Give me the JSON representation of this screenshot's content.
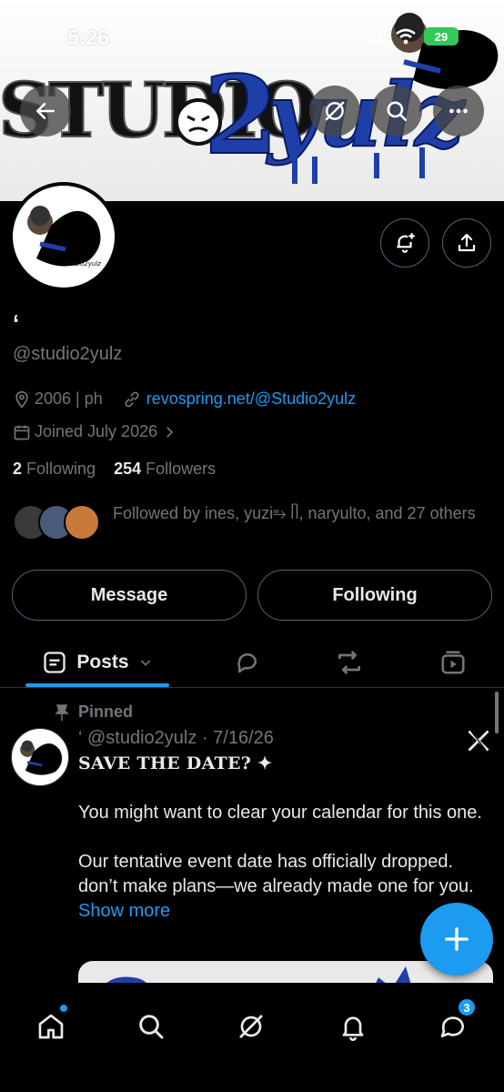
{
  "status_bar": {
    "time": "5:26",
    "battery": "29"
  },
  "banner": {
    "brand_text": "STUDIO",
    "brand_number": "2",
    "brand_suffix": "yulz"
  },
  "profile": {
    "display_name": "‘",
    "handle": "@studio2yulz",
    "location": "2006 | ph",
    "website": "revospring.net/@Studio2yulz",
    "joined": "Joined July 2026",
    "following_count": "2",
    "following_label": "Following",
    "followers_count": "254",
    "followers_label": "Followers",
    "followed_by": "Followed by ines, yuzi⥱ ᥥ, naryulto, and 27 others"
  },
  "actions": {
    "message": "Message",
    "following": "Following"
  },
  "tabs": {
    "posts": "Posts"
  },
  "post": {
    "pinned_label": "Pinned",
    "author": "‘ @studio2yulz",
    "separator": "·",
    "date": "7/16/26",
    "title": "SAVE THE DATE? ✦",
    "paragraph_1": "You might want to clear your calendar for this one.",
    "paragraph_2": "Our tentative event date has officially dropped. don’t make plans—we already made one for you.",
    "show_more": "Show more"
  },
  "nav": {
    "messages_badge": "3"
  },
  "colors": {
    "accent": "#1d9bf0",
    "muted": "#71767b",
    "text": "#e7e9ea",
    "border": "#536471"
  },
  "icons": [
    "back-arrow-icon",
    "grok-icon",
    "search-icon",
    "more-icon",
    "notify-plus-icon",
    "share-icon",
    "location-icon",
    "link-icon",
    "calendar-icon",
    "chevron-right-icon",
    "posts-icon",
    "chevron-down-icon",
    "replies-icon",
    "reposts-icon",
    "media-icon",
    "pin-icon",
    "x-logo-icon",
    "compose-icon",
    "home-icon",
    "notifications-icon",
    "messages-icon"
  ]
}
